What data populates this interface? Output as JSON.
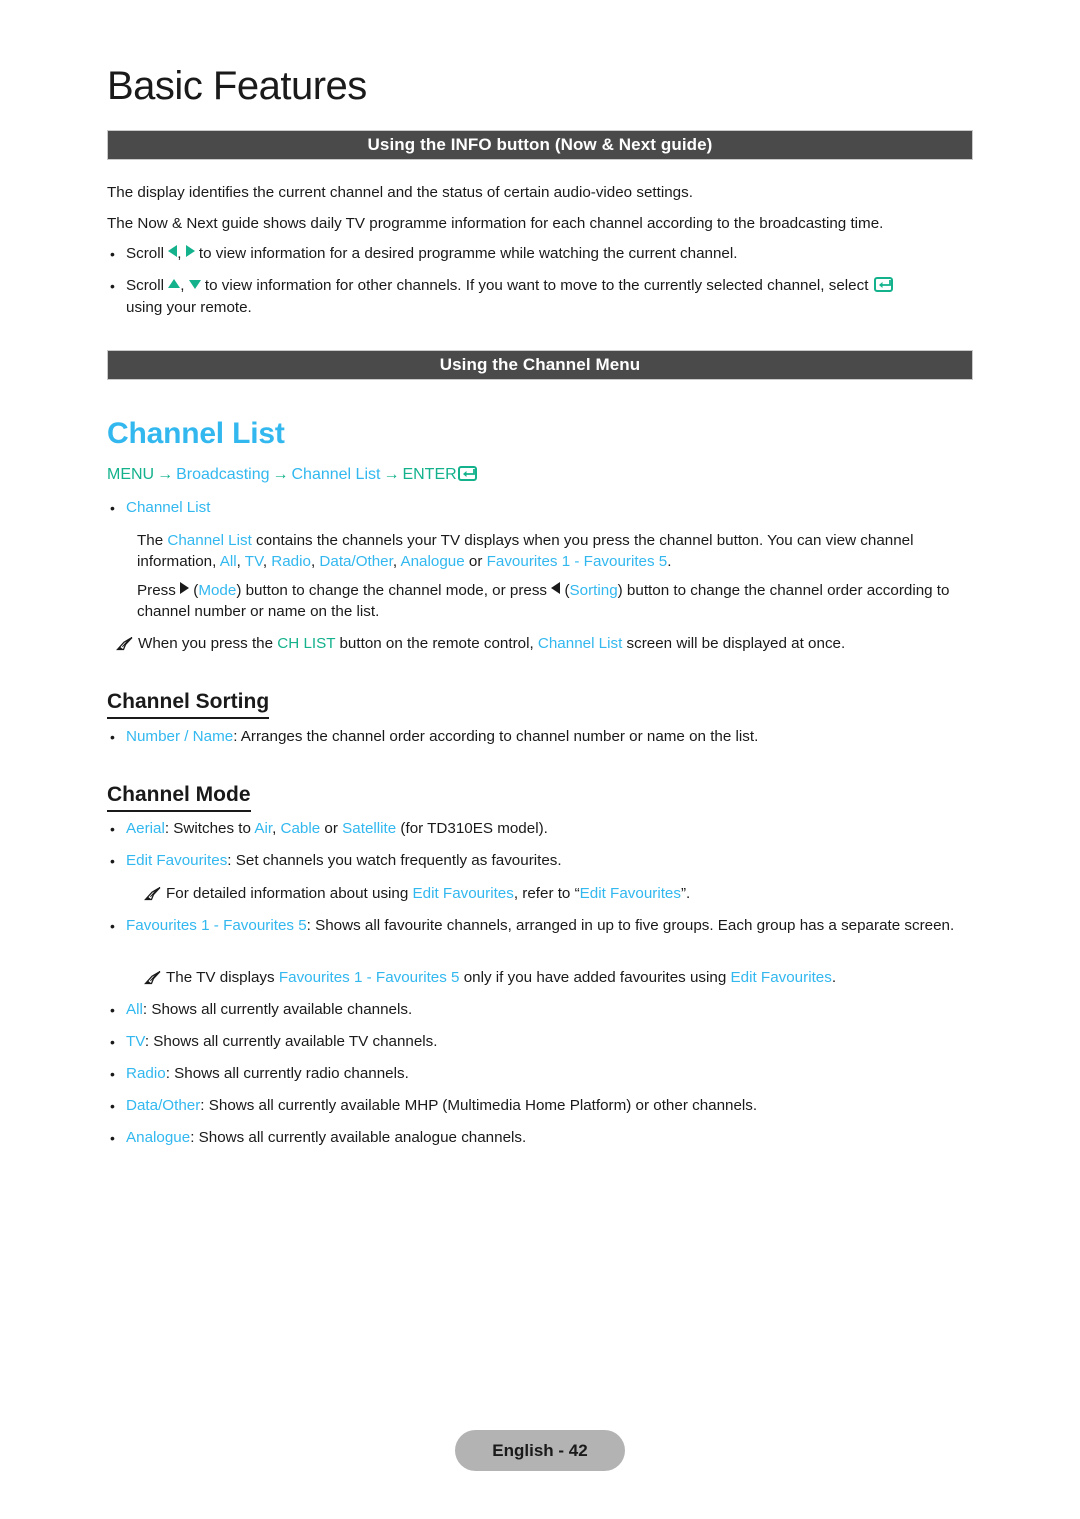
{
  "document": {
    "chapter_title": "Basic Features",
    "page_footer": "English - 42"
  },
  "sections": {
    "info_bar": "Using the INFO button (Now & Next guide)",
    "channel_bar": "Using the Channel Menu"
  },
  "info_section": {
    "para1": "The display identifies the current channel and the status of certain audio-video settings.",
    "para2": "The Now & Next guide shows daily TV programme information for each channel according to the broadcasting time.",
    "bullet1": {
      "lead": "Scroll ",
      "tail": " to view information for a desired programme while watching the current channel.",
      "separator": ", "
    },
    "bullet2": {
      "lead": "Scroll ",
      "separator": ", ",
      "mid": " to view information for other channels. If you want to move to the currently selected channel, select ",
      "tail": "using your remote."
    }
  },
  "channel_list": {
    "heading": "Channel List",
    "breadcrumb": {
      "menu": "MENU",
      "arrow": "→",
      "broadcasting": "Broadcasting",
      "channel_list": "Channel List",
      "enter": "ENTER"
    },
    "sub_bullet": "Channel List",
    "para_a": {
      "t1": "The ",
      "k1": "Channel List",
      "t2": " contains the channels your TV displays when you press the channel button. You can view channel information, ",
      "k2": "All",
      "t3": ", ",
      "k3": "TV",
      "t4": ", ",
      "k4": "Radio",
      "t5": ", ",
      "k5": "Data/Other",
      "t6": ", ",
      "k6": "Analogue",
      "t7": " or ",
      "k7": "Favourites 1 - Favourites 5",
      "t8": "."
    },
    "para_b": {
      "t1": "Press ",
      "t2": " (",
      "k1": "Mode",
      "t3": ") button to change the channel mode, or press ",
      "t4": " (",
      "k2": "Sorting",
      "t5": ") button to change the channel order according to channel number or name on the list."
    },
    "note1": {
      "t1": "When you press the ",
      "k1": "CH LIST",
      "t2": " button on the remote control, ",
      "k2": "Channel List",
      "t3": " screen will be displayed at once."
    }
  },
  "channel_sorting": {
    "heading": "Channel Sorting",
    "bullet": {
      "key": "Number / Name",
      "text": ": Arranges the channel order according to channel number or name on the list."
    }
  },
  "channel_mode": {
    "heading": "Channel Mode",
    "aerial": {
      "key": "Aerial",
      "t1": ": Switches to ",
      "k1": "Air",
      "t2": ", ",
      "k2": "Cable",
      "t3": " or ",
      "k3": "Satellite",
      "t4": " (for TD310ES model)."
    },
    "edit_favourites": {
      "key": "Edit Favourites",
      "text": ": Set channels you watch frequently as favourites."
    },
    "note_edit": {
      "t1": "For detailed information about using ",
      "k1": "Edit Favourites",
      "t2": ", refer to “",
      "k2": "Edit Favourites",
      "t3": "”."
    },
    "favourites": {
      "k1": "Favourites 1",
      "sep": " - ",
      "k2": "Favourites 5",
      "text": ": Shows all favourite channels, arranged in up to five groups. Each group has a separate screen."
    },
    "note_fav": {
      "t1": "The TV displays ",
      "k1": "Favourites 1",
      "sep": " - ",
      "k2": "Favourites 5",
      "t2": " only if you have added favourites using ",
      "k3": "Edit Favourites",
      "t3": "."
    },
    "all": {
      "key": "All",
      "text": ": Shows all currently available channels."
    },
    "tv": {
      "key": "TV",
      "text": ": Shows all currently available TV channels."
    },
    "radio": {
      "key": "Radio",
      "text": ": Shows all currently radio channels."
    },
    "data_other": {
      "key": "Data/Other",
      "text": ": Shows all currently available MHP (Multimedia Home Platform) or other channels."
    },
    "analogue": {
      "key": "Analogue",
      "text": ": Shows all currently available analogue channels."
    }
  },
  "glyphs": {
    "bullet_dot": "●"
  },
  "colors": {
    "blue": "#32b8ef",
    "teal": "#13b28c",
    "bar": "#4a4a4a",
    "pill": "#b3b3b3"
  }
}
